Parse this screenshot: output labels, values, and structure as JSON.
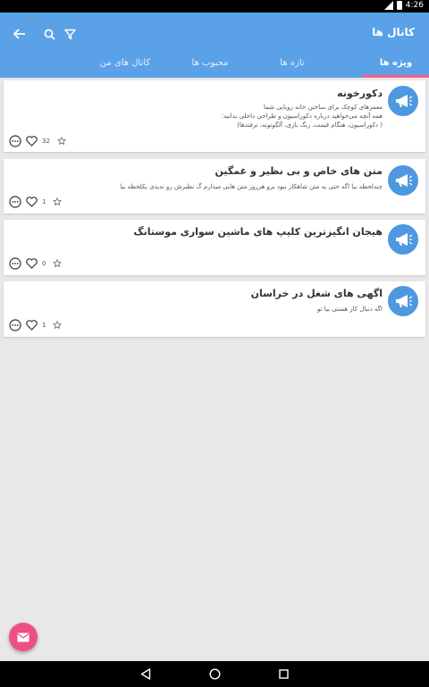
{
  "status": {
    "time": "4:26"
  },
  "header": {
    "title": "کانال ها"
  },
  "tabs": [
    {
      "label": "ویژه ها"
    },
    {
      "label": "تازه ها"
    },
    {
      "label": "محبوب ها"
    },
    {
      "label": "کانال های من"
    }
  ],
  "colors": {
    "primary": "#5aa1e8",
    "accent": "#ee4f86",
    "tab_indicator": "#ff5c8a"
  },
  "channels": [
    {
      "title": "دکورخونه",
      "description": [
        "معمرهای کوچک برای ساختن خانه رویایی شما",
        "همه آنچه می‌خواهید درباره دکوراسیون و طراحی داخلی بدانید:",
        "( دکوراسیون، هنگام قیمت، رنگ بازی، آلگوتونه، ترفندها)"
      ],
      "likes": "32",
      "avatar_icon": "megaphone-icon"
    },
    {
      "title": "متن های خاص و بی نظیر و غمگین",
      "description": [
        "چندلحظه بیا اگه حتی یه متن شاهکار نبود برو هرروز متن هایی میذارم گ نظیرش رو ندیدی یکلحظه بیا"
      ],
      "likes": "1",
      "avatar_icon": "megaphone-icon"
    },
    {
      "title": "هیجان انگیزترین کلیپ های ماشین سواری موستانگ",
      "description": [],
      "likes": "0",
      "avatar_icon": "megaphone-icon"
    },
    {
      "title": "اگهی های شغل در خراسان",
      "description": [
        "اگه دنبال کار هستی بیا تو"
      ],
      "likes": "1",
      "avatar_icon": "megaphone-icon"
    }
  ]
}
